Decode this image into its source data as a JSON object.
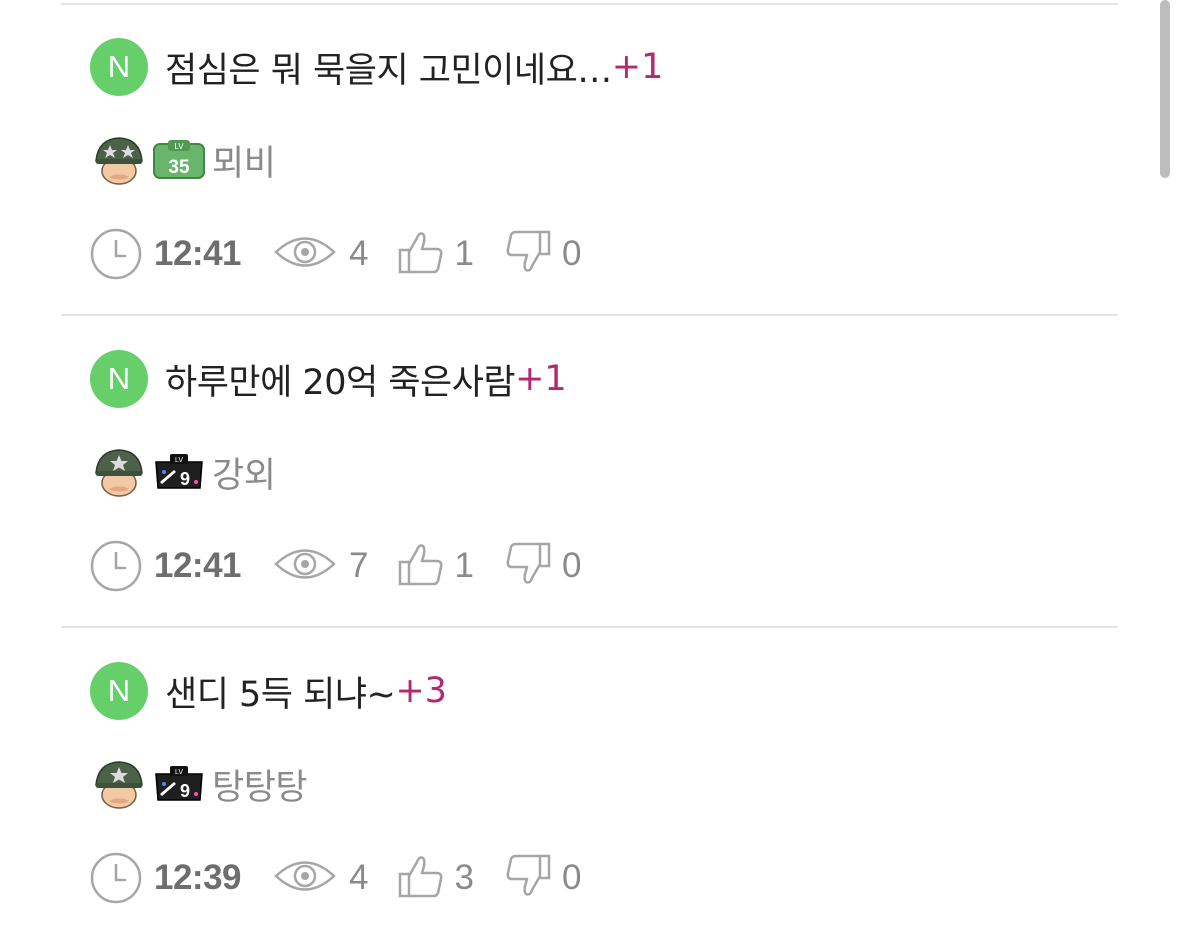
{
  "colors": {
    "new_badge": "#66cf6a",
    "comment_count": "#b5276e",
    "title_text": "#222222",
    "meta_text": "#8a8a8a",
    "divider": "#e4e4e4"
  },
  "posts": [
    {
      "badge": "N",
      "title": "점심은 뭐 묵을지 고민이네요…",
      "comment_count": "+1",
      "author": "뫼비",
      "level_label": "LV",
      "level": "35",
      "level_icon": "green-level-badge",
      "avatar_icon": "soldier-helmet-avatar",
      "time": "12:41",
      "views": "4",
      "likes": "1",
      "dislikes": "0"
    },
    {
      "badge": "N",
      "title": "하루만에 20억 죽은사람",
      "comment_count": "+1",
      "author": "강외",
      "level_label": "LV",
      "level": "9",
      "level_icon": "black-level-badge",
      "avatar_icon": "soldier-helmet-avatar",
      "time": "12:41",
      "views": "7",
      "likes": "1",
      "dislikes": "0"
    },
    {
      "badge": "N",
      "title": "샌디 5득 되냐~",
      "comment_count": "+3",
      "author": "탕탕탕",
      "level_label": "LV",
      "level": "9",
      "level_icon": "black-level-badge",
      "avatar_icon": "soldier-helmet-avatar",
      "time": "12:39",
      "views": "4",
      "likes": "3",
      "dislikes": "0"
    }
  ]
}
